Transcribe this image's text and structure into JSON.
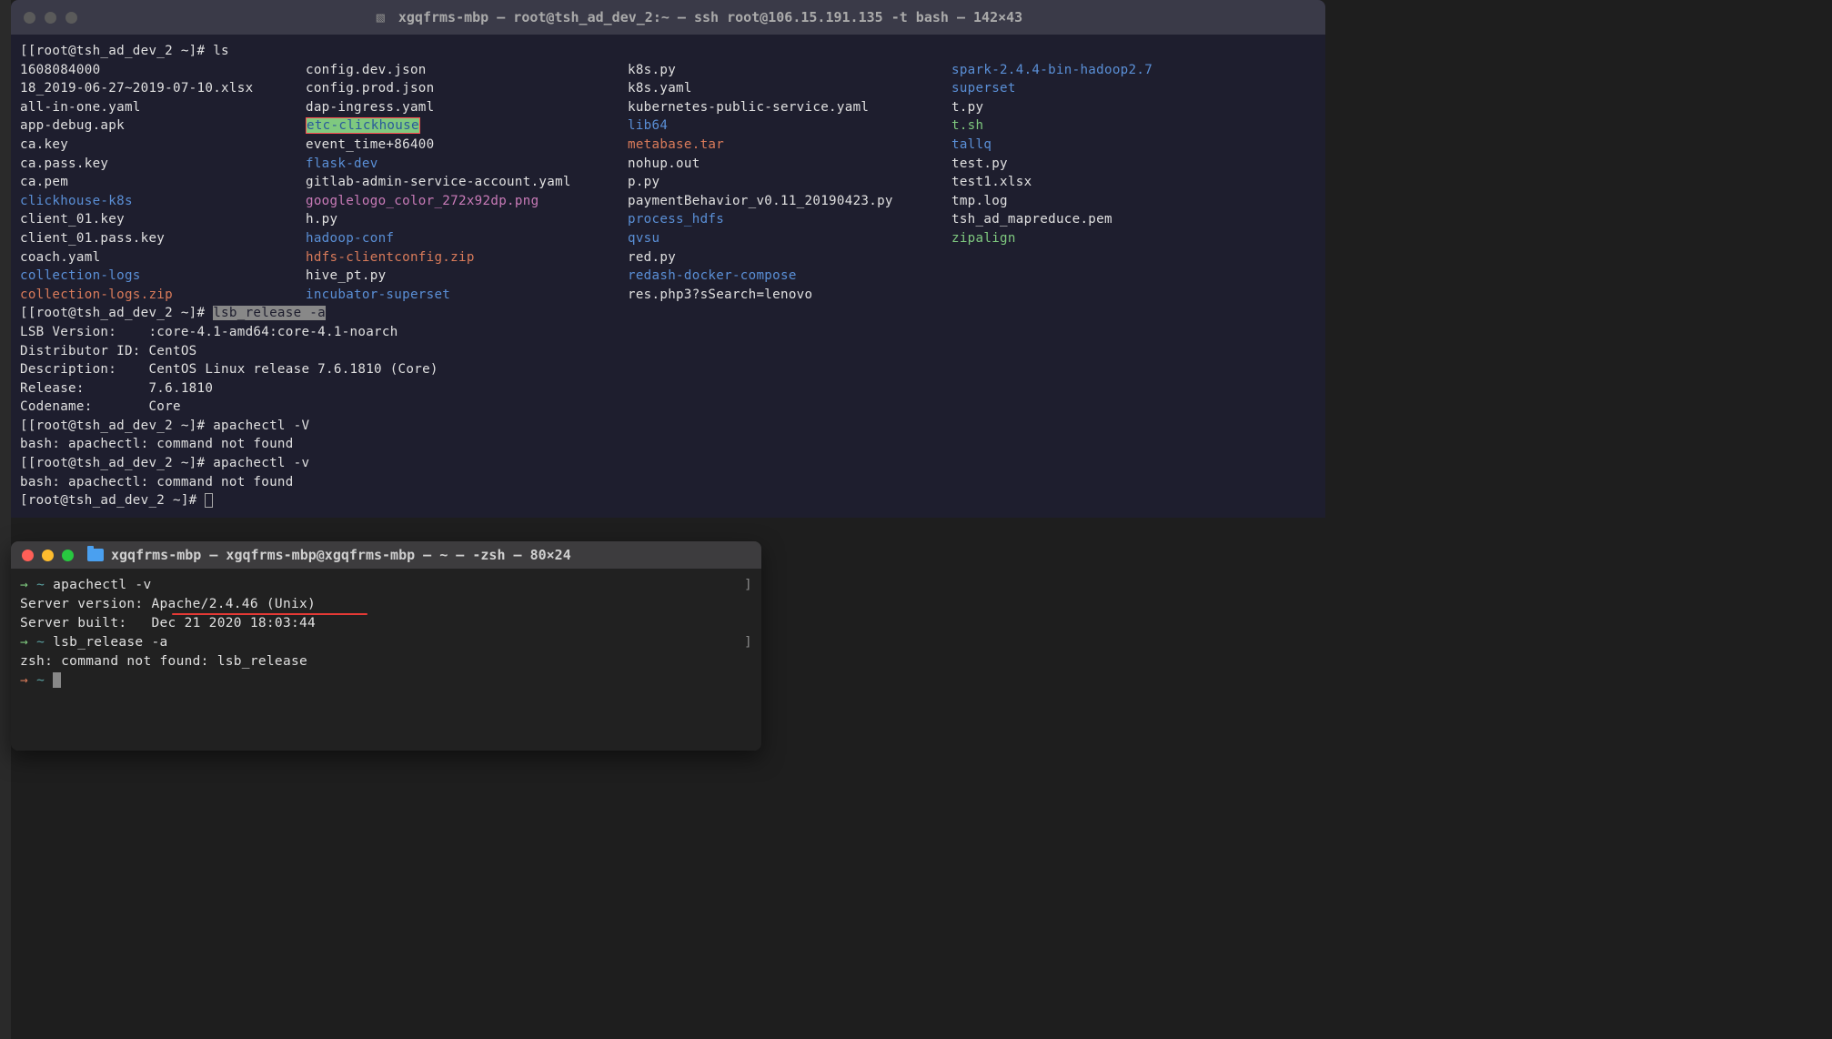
{
  "window1": {
    "title": "xgqfrms-mbp — root@tsh_ad_dev_2:~ — ssh root@106.15.191.135 -t bash — 142×43",
    "prompt": "[[root@tsh_ad_dev_2 ~]# ",
    "prompt_short": "[root@tsh_ad_dev_2 ~]# ",
    "cmd_ls": "ls",
    "cmd_lsb": "lsb_release -a",
    "cmd_apV": "apachectl -V",
    "cmd_apv": "apachectl -v",
    "err_apache": "bash: apachectl: command not found",
    "lsb_out": {
      "l1": "LSB Version:    :core-4.1-amd64:core-4.1-noarch",
      "l2": "Distributor ID: CentOS",
      "l3": "Description:    CentOS Linux release 7.6.1810 (Core)",
      "l4": "Release:        7.6.1810",
      "l5": "Codename:       Core"
    },
    "files": {
      "r0c0": "1608084000",
      "r0c1": "config.dev.json",
      "r0c2": "k8s.py",
      "r0c3": "spark-2.4.4-bin-hadoop2.7",
      "r1c0": "18_2019-06-27~2019-07-10.xlsx",
      "r1c1": "config.prod.json",
      "r1c2": "k8s.yaml",
      "r1c3": "superset",
      "r2c0": "all-in-one.yaml",
      "r2c1": "dap-ingress.yaml",
      "r2c2": "kubernetes-public-service.yaml",
      "r2c3": "t.py",
      "r3c0": "app-debug.apk",
      "r3c1": "etc-clickhouse",
      "r3c2": "lib64",
      "r3c3": "t.sh",
      "r4c0": "ca.key",
      "r4c1": "event_time+86400",
      "r4c2": "metabase.tar",
      "r4c3": "tallq",
      "r5c0": "ca.pass.key",
      "r5c1": "flask-dev",
      "r5c2": "nohup.out",
      "r5c3": "test.py",
      "r6c0": "ca.pem",
      "r6c1": "gitlab-admin-service-account.yaml",
      "r6c2": "p.py",
      "r6c3": "test1.xlsx",
      "r7c0": "clickhouse-k8s",
      "r7c1": "googlelogo_color_272x92dp.png",
      "r7c2": "paymentBehavior_v0.11_20190423.py",
      "r7c3": "tmp.log",
      "r8c0": "client_01.key",
      "r8c1": "h.py",
      "r8c2": "process_hdfs",
      "r8c3": "tsh_ad_mapreduce.pem",
      "r9c0": "client_01.pass.key",
      "r9c1": "hadoop-conf",
      "r9c2": "qvsu",
      "r9c3": "zipalign",
      "r10c0": "coach.yaml",
      "r10c1": "hdfs-clientconfig.zip",
      "r10c2": "red.py",
      "r11c0": "collection-logs",
      "r11c1": "hive_pt.py",
      "r11c2": "redash-docker-compose",
      "r12c0": "collection-logs.zip",
      "r12c1": "incubator-superset",
      "r12c2": "res.php3?sSearch=lenovo"
    }
  },
  "window2": {
    "title": "xgqfrms-mbp — xgqfrms-mbp@xgqfrms-mbp — ~ — -zsh — 80×24",
    "arrow": "→",
    "tilde": "~",
    "cmd_apv": "apachectl -v",
    "sv_label": "Server version: ",
    "sv_val": "Apache/2.4.46 (Unix)",
    "sb": "Server built:   Dec 21 2020 18:03:44",
    "cmd_lsb": "lsb_release -a",
    "err_lsb": "zsh: command not found: lsb_release"
  }
}
